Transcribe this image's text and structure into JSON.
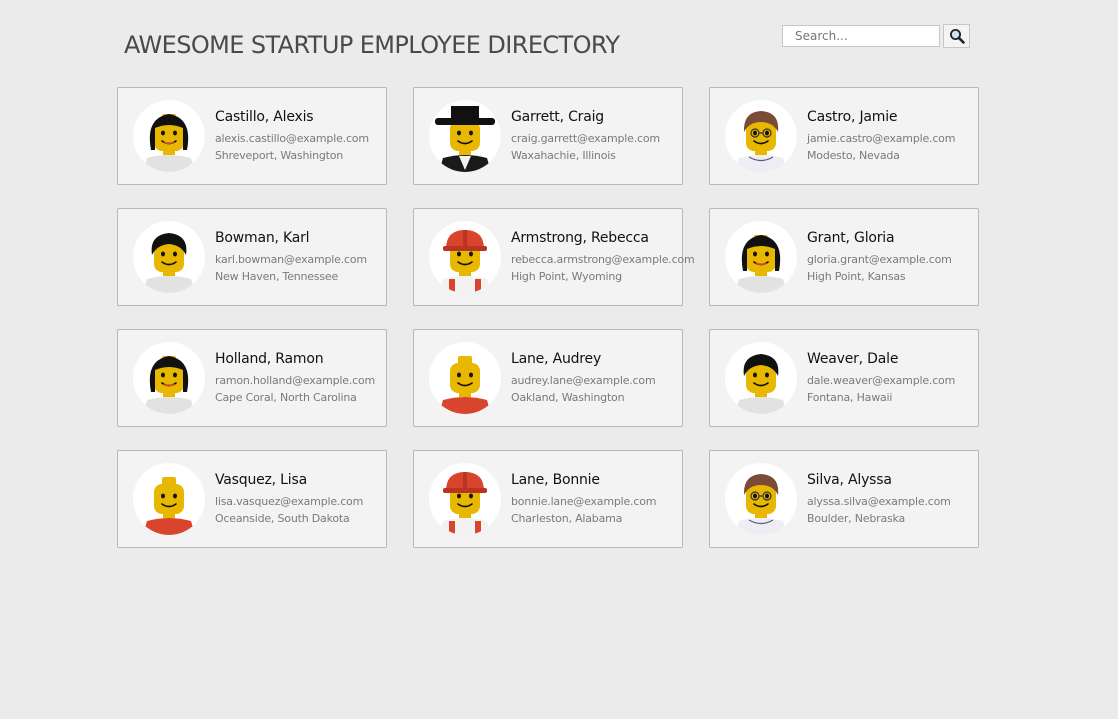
{
  "header": {
    "title": "AWESOME STARTUP EMPLOYEE DIRECTORY"
  },
  "search": {
    "placeholder": "Search...",
    "button_icon": "magnifier-icon"
  },
  "employees": [
    {
      "name": "Castillo, Alexis",
      "email": "alexis.castillo@example.com",
      "location": "Shreveport, Washington",
      "avatar": "lego-long-black-hair"
    },
    {
      "name": "Garrett, Craig",
      "email": "craig.garrett@example.com",
      "location": "Waxahachie, Illinois",
      "avatar": "lego-black-top-hat"
    },
    {
      "name": "Castro, Jamie",
      "email": "jamie.castro@example.com",
      "location": "Modesto, Nevada",
      "avatar": "lego-brown-hair-glasses"
    },
    {
      "name": "Bowman, Karl",
      "email": "karl.bowman@example.com",
      "location": "New Haven, Tennessee",
      "avatar": "lego-short-black-hair"
    },
    {
      "name": "Armstrong, Rebecca",
      "email": "rebecca.armstrong@example.com",
      "location": "High Point, Wyoming",
      "avatar": "lego-red-hard-hat"
    },
    {
      "name": "Grant, Gloria",
      "email": "gloria.grant@example.com",
      "location": "High Point, Kansas",
      "avatar": "lego-long-black-hair"
    },
    {
      "name": "Holland, Ramon",
      "email": "ramon.holland@example.com",
      "location": "Cape Coral, North Carolina",
      "avatar": "lego-long-black-hair"
    },
    {
      "name": "Lane, Audrey",
      "email": "audrey.lane@example.com",
      "location": "Oakland, Washington",
      "avatar": "lego-bald-red-shirt"
    },
    {
      "name": "Weaver, Dale",
      "email": "dale.weaver@example.com",
      "location": "Fontana, Hawaii",
      "avatar": "lego-short-black-hair"
    },
    {
      "name": "Vasquez, Lisa",
      "email": "lisa.vasquez@example.com",
      "location": "Oceanside, South Dakota",
      "avatar": "lego-bald-red-shirt"
    },
    {
      "name": "Lane, Bonnie",
      "email": "bonnie.lane@example.com",
      "location": "Charleston, Alabama",
      "avatar": "lego-red-hard-hat"
    },
    {
      "name": "Silva, Alyssa",
      "email": "alyssa.silva@example.com",
      "location": "Boulder, Nebraska",
      "avatar": "lego-brown-hair-glasses"
    }
  ],
  "colors": {
    "background": "#ebebeb",
    "card": "#f3f3f3",
    "card_border": "#b7b7b7",
    "lego_yellow": "#e8b700",
    "lego_red": "#d8452c",
    "hair_black": "#111111",
    "hair_brown": "#7a4b36"
  }
}
